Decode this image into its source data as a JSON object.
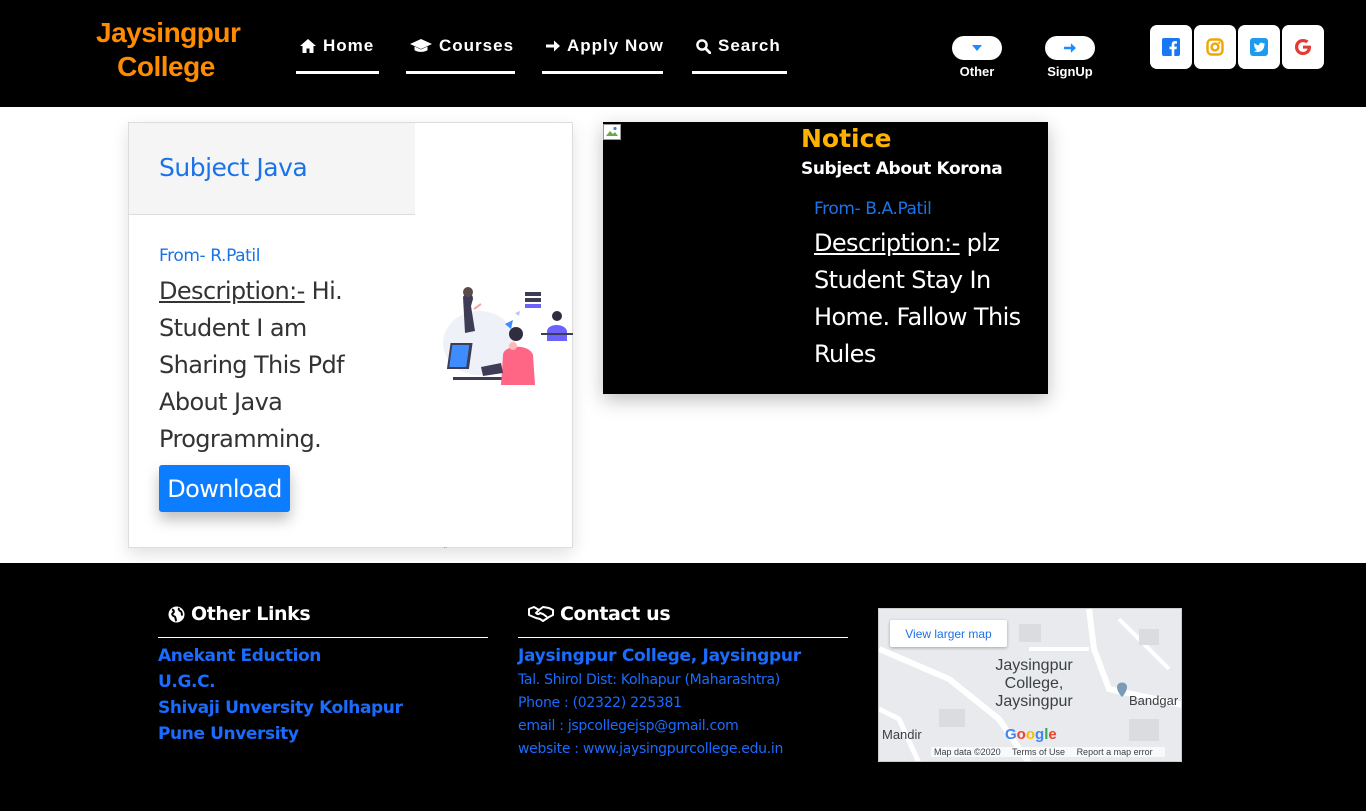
{
  "header": {
    "brand_line1": "Jaysingpur",
    "brand_line2": "College",
    "brand_color": "#ff8c00",
    "nav": [
      {
        "label": "Home",
        "icon": "home-icon"
      },
      {
        "label": "Courses",
        "icon": "graduation-cap-icon"
      },
      {
        "label": "Apply Now",
        "icon": "arrow-right-icon"
      },
      {
        "label": "Search",
        "icon": "search-icon"
      }
    ],
    "other_label": "Other",
    "signup_label": "SignUp",
    "socials": [
      "facebook-icon",
      "instagram-icon",
      "twitter-icon",
      "google-icon"
    ]
  },
  "subject_card": {
    "title": "Subject Java",
    "from": "From- R.Patil",
    "desc_label": "Description:-",
    "desc_text": " Hi. Student I am Sharing This Pdf About Java Programming.",
    "download_label": "Download",
    "accent": "#0d7dff"
  },
  "notice": {
    "title": "Notice",
    "subject": "Subject About Korona",
    "from": "From- B.A.Patil",
    "desc_label": "Description:-",
    "desc_text": " plz Student Stay In Home. Fallow This Rules",
    "title_color": "#ffb300"
  },
  "footer": {
    "links_heading": "Other Links",
    "links": [
      "Anekant Eduction",
      "U.G.C.",
      "Shivaji Unversity Kolhapur",
      "Pune Unversity"
    ],
    "contact_heading": "Contact us",
    "contact": {
      "name": "Jaysingpur College, Jaysingpur",
      "address": "Tal. Shirol Dist: Kolhapur (Maharashtra)",
      "phone": "Phone : (02322) 225381",
      "email": "email : jspcollegejsp@gmail.com",
      "website": "website : www.jaysingpurcollege.edu.in"
    },
    "link_color": "#1a6cff",
    "map": {
      "view_larger": "View larger map",
      "place_line1": "Jaysingpur",
      "place_line2": "College,",
      "place_line3": "Jaysingpur",
      "label_bandgar": "Bandgar",
      "label_mandir": "Mandir",
      "google": "Google",
      "map_data": "Map data ©2020",
      "terms": "Terms of Use",
      "report": "Report a map error"
    }
  }
}
